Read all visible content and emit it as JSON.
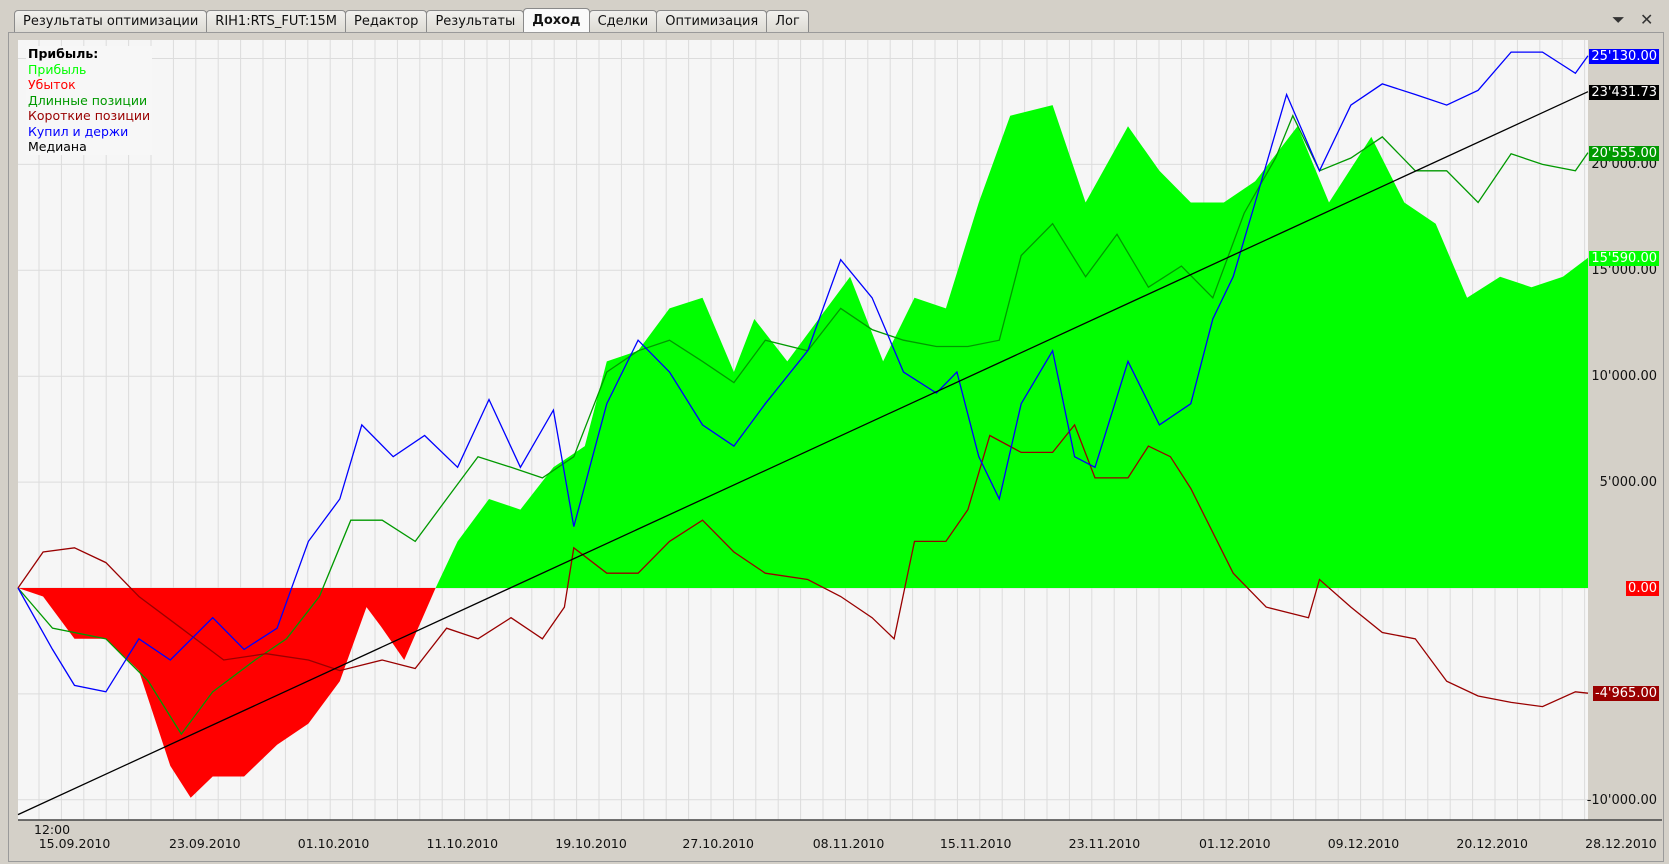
{
  "tabs": [
    "Результаты оптимизации",
    "RIH1:RTS_FUT:15M",
    "Редактор",
    "Результаты",
    "Доход",
    "Сделки",
    "Оптимизация",
    "Лог"
  ],
  "active_tab": 4,
  "controls": {
    "menu_icon": "chevron-menu-icon",
    "close_icon": "close-icon",
    "menu_glyph": "⏷",
    "close_glyph": "✕"
  },
  "legend": {
    "title": "Прибыль:",
    "items": [
      {
        "label": "Прибыль",
        "color": "#00ff00"
      },
      {
        "label": "Убыток",
        "color": "#ff0000"
      },
      {
        "label": "Длинные позиции",
        "color": "#009900"
      },
      {
        "label": "Короткие позиции",
        "color": "#990000"
      },
      {
        "label": "Купил и держи",
        "color": "#0000ff"
      },
      {
        "label": "Медиана",
        "color": "#000000"
      }
    ]
  },
  "chart_data": {
    "type": "line",
    "xlabel": "",
    "ylabel": "",
    "x_range": [
      0,
      1000
    ],
    "ylim": [
      -10700,
      26500
    ],
    "time_label": "12:00",
    "x_ticks": [
      {
        "x": 36,
        "label": "15.09.2010"
      },
      {
        "x": 119,
        "label": "23.09.2010"
      },
      {
        "x": 201,
        "label": "01.10.2010"
      },
      {
        "x": 283,
        "label": "11.10.2010"
      },
      {
        "x": 365,
        "label": "19.10.2010"
      },
      {
        "x": 446,
        "label": "27.10.2010"
      },
      {
        "x": 529,
        "label": "08.11.2010"
      },
      {
        "x": 610,
        "label": "15.11.2010"
      },
      {
        "x": 692,
        "label": "23.11.2010"
      },
      {
        "x": 775,
        "label": "01.12.2010"
      },
      {
        "x": 857,
        "label": "09.12.2010"
      },
      {
        "x": 939,
        "label": "20.12.2010"
      },
      {
        "x": 1021,
        "label": "28.12.2010"
      }
    ],
    "y_ticks": [
      {
        "v": -10000,
        "label": "-10'000.00"
      },
      {
        "v": 5000,
        "label": "5'000.00"
      },
      {
        "v": 10000,
        "label": "10'000.00"
      },
      {
        "v": 15000,
        "label": "15'000.00"
      },
      {
        "v": 20000,
        "label": "20'000.00"
      }
    ],
    "value_labels": [
      {
        "v": 25130,
        "label": "25'130.00",
        "bg": "#0000ff",
        "fg": "#ffffff"
      },
      {
        "v": 23431.73,
        "label": "23'431.73",
        "bg": "#000000",
        "fg": "#ffffff"
      },
      {
        "v": 20555,
        "label": "20'555.00",
        "bg": "#009900",
        "fg": "#ffffff"
      },
      {
        "v": 15590,
        "label": "15'590.00",
        "bg": "#00ff00",
        "fg": "#ffffff"
      },
      {
        "v": 0,
        "label": "0.00",
        "bg": "#ff0000",
        "fg": "#ffffff"
      },
      {
        "v": -4965,
        "label": "-4'965.00",
        "bg": "#990000",
        "fg": "#ffffff"
      }
    ],
    "series": [
      {
        "name": "Прибыль",
        "type": "area",
        "pos_color": "#00ff00",
        "neg_color": "#ff0000",
        "x": [
          0,
          16,
          36,
          56,
          77,
          97,
          110,
          124,
          144,
          165,
          185,
          205,
          222,
          232,
          246,
          266,
          280,
          300,
          320,
          341,
          361,
          375,
          395,
          415,
          436,
          456,
          469,
          490,
          510,
          530,
          551,
          571,
          591,
          612,
          632,
          659,
          680,
          707,
          727,
          747,
          768,
          788,
          815,
          835,
          862,
          883,
          903,
          923,
          944,
          964,
          984,
          1000
        ],
        "y": [
          0,
          -400,
          -2400,
          -2400,
          -3900,
          -8400,
          -9900,
          -8900,
          -8900,
          -7400,
          -6400,
          -4400,
          -900,
          -1900,
          -3400,
          0,
          2200,
          4200,
          3700,
          5700,
          6700,
          10700,
          11200,
          13200,
          13700,
          10200,
          12700,
          10700,
          12700,
          14700,
          10700,
          13700,
          13200,
          18200,
          22300,
          22800,
          18200,
          21800,
          19700,
          18200,
          18200,
          19200,
          21800,
          18200,
          21300,
          18200,
          17200,
          13700,
          14700,
          14200,
          14700,
          15590
        ]
      },
      {
        "name": "Длинные позиции",
        "type": "line",
        "color": "#009900",
        "x": [
          0,
          22,
          56,
          83,
          104,
          124,
          151,
          171,
          192,
          212,
          232,
          253,
          273,
          293,
          314,
          334,
          354,
          375,
          395,
          415,
          436,
          456,
          476,
          503,
          524,
          544,
          564,
          585,
          605,
          625,
          639,
          659,
          680,
          700,
          720,
          741,
          761,
          781,
          801,
          812,
          829,
          849,
          869,
          890,
          910,
          930,
          951,
          971,
          992,
          1000
        ],
        "y": [
          0,
          -1900,
          -2400,
          -4400,
          -6900,
          -4900,
          -3400,
          -2400,
          -400,
          3200,
          3200,
          2200,
          4200,
          6200,
          5700,
          5200,
          6200,
          10200,
          11200,
          11700,
          10700,
          9700,
          11700,
          11200,
          13200,
          12200,
          11700,
          11400,
          11400,
          11700,
          15700,
          17200,
          14700,
          16700,
          14200,
          15200,
          13700,
          17700,
          20300,
          22300,
          19700,
          20300,
          21300,
          19700,
          19700,
          18200,
          20500,
          20000,
          19700,
          20555
        ]
      },
      {
        "name": "Короткие позиции",
        "type": "line",
        "color": "#990000",
        "x": [
          0,
          16,
          36,
          56,
          77,
          104,
          131,
          158,
          185,
          205,
          232,
          253,
          273,
          293,
          314,
          334,
          348,
          354,
          375,
          395,
          415,
          436,
          456,
          476,
          503,
          524,
          544,
          558,
          571,
          591,
          605,
          619,
          639,
          659,
          673,
          686,
          707,
          720,
          734,
          747,
          774,
          795,
          822,
          829,
          849,
          869,
          890,
          910,
          930,
          951,
          971,
          992,
          1000
        ],
        "y": [
          0,
          1700,
          1900,
          1200,
          -400,
          -1900,
          -3400,
          -3100,
          -3400,
          -3900,
          -3400,
          -3800,
          -1900,
          -2400,
          -1400,
          -2400,
          -900,
          1900,
          700,
          700,
          2200,
          3200,
          1700,
          700,
          400,
          -400,
          -1400,
          -2400,
          2200,
          2200,
          3700,
          7200,
          6400,
          6400,
          7700,
          5200,
          5200,
          6700,
          6200,
          4700,
          700,
          -900,
          -1400,
          400,
          -900,
          -2100,
          -2400,
          -4400,
          -5100,
          -5400,
          -5600,
          -4900,
          -4965
        ]
      },
      {
        "name": "Купил и держи",
        "type": "line",
        "color": "#0000ff",
        "x": [
          0,
          22,
          36,
          56,
          77,
          97,
          124,
          144,
          165,
          185,
          205,
          219,
          239,
          259,
          280,
          300,
          320,
          341,
          354,
          375,
          395,
          415,
          436,
          456,
          476,
          503,
          524,
          544,
          564,
          585,
          598,
          612,
          625,
          639,
          659,
          673,
          686,
          707,
          727,
          747,
          761,
          774,
          788,
          808,
          829,
          849,
          869,
          890,
          910,
          930,
          951,
          971,
          992,
          1000
        ],
        "y": [
          0,
          -2900,
          -4600,
          -4900,
          -2400,
          -3400,
          -1400,
          -2900,
          -1900,
          2200,
          4200,
          7700,
          6200,
          7200,
          5700,
          8900,
          5700,
          8400,
          2900,
          8700,
          11700,
          10200,
          7700,
          6700,
          8700,
          11200,
          15500,
          13700,
          10200,
          9200,
          10200,
          6200,
          4200,
          8700,
          11200,
          6200,
          5700,
          10700,
          7700,
          8700,
          12700,
          14700,
          18200,
          23300,
          19700,
          22800,
          23800,
          23300,
          22800,
          23500,
          25300,
          25300,
          24300,
          25130
        ]
      },
      {
        "name": "Медиана",
        "type": "line",
        "color": "#000000",
        "x": [
          0,
          1000
        ],
        "y": [
          -10700,
          23431.73
        ]
      }
    ]
  }
}
